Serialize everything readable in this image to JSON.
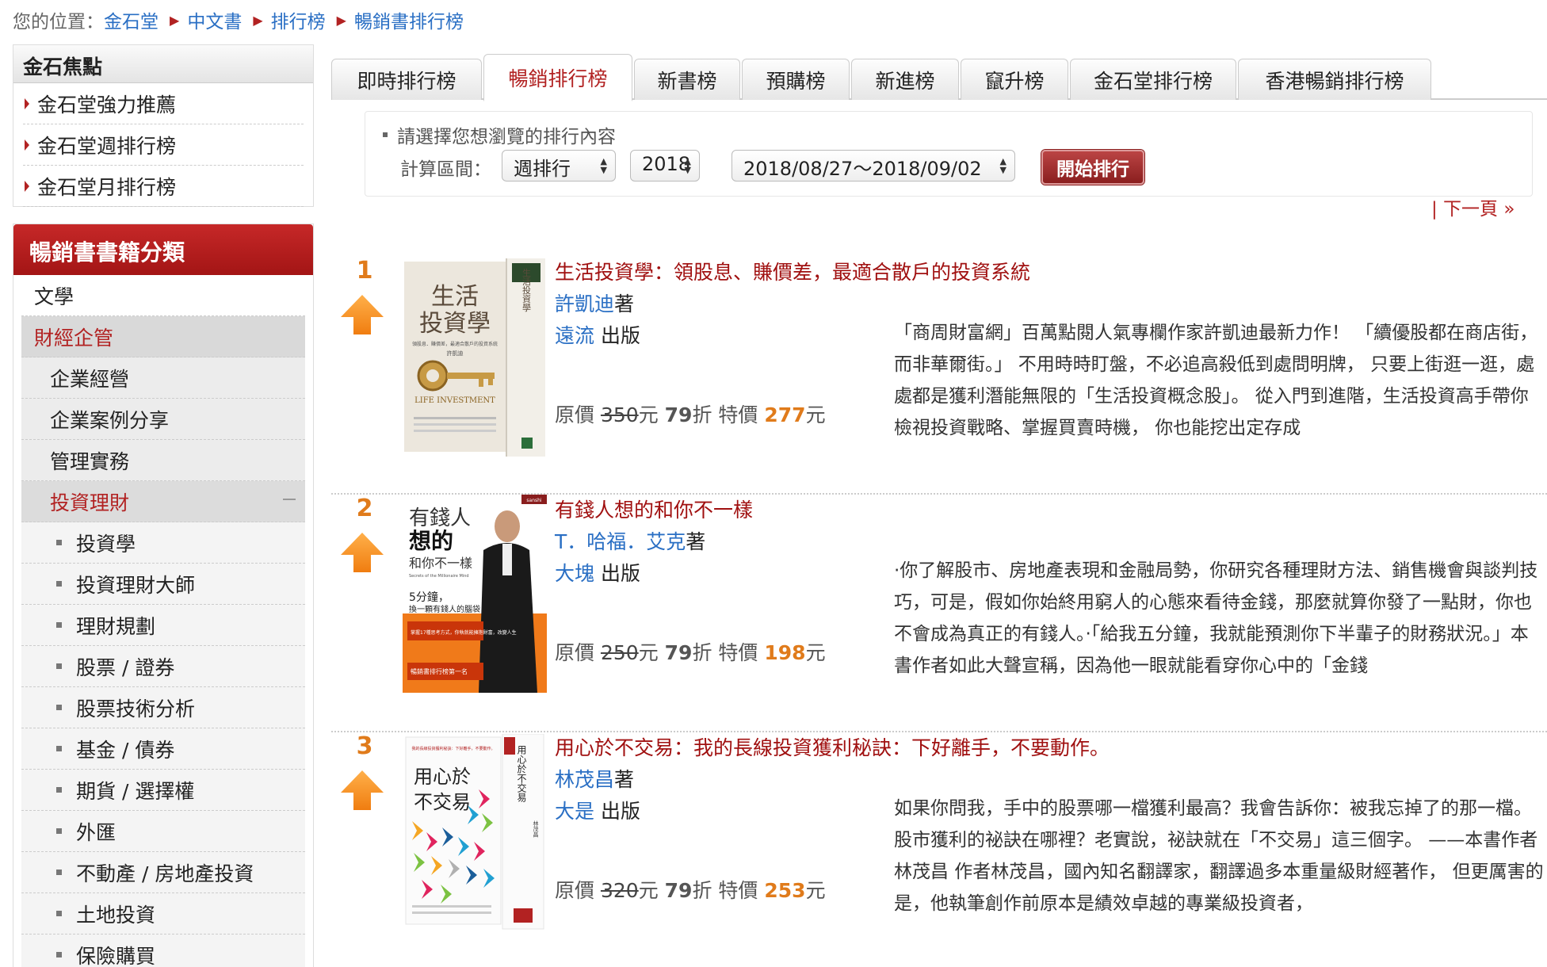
{
  "breadcrumb": {
    "label": "您的位置：",
    "items": [
      "金石堂",
      "中文書",
      "排行榜",
      "暢銷書排行榜"
    ]
  },
  "sidebar": {
    "focus": {
      "title": "金石焦點",
      "items": [
        "金石堂強力推薦",
        "金石堂週排行榜",
        "金石堂月排行榜"
      ]
    },
    "categories": {
      "title": "暢銷書書籍分類",
      "top": [
        "文學",
        "財經企管"
      ],
      "sub": [
        "企業經營",
        "企業案例分享",
        "管理實務",
        "投資理財"
      ],
      "subsub": [
        "投資學",
        "投資理財大師",
        "理財規劃",
        "股票 / 證券",
        "股票技術分析",
        "基金 / 債券",
        "期貨 / 選擇權",
        "外匯",
        "不動產 / 房地產投資",
        "土地投資",
        "保險購買"
      ]
    }
  },
  "tabs": [
    "即時排行榜",
    "暢銷排行榜",
    "新書榜",
    "預購榜",
    "新進榜",
    "竄升榜",
    "金石堂排行榜",
    "香港暢銷排行榜"
  ],
  "active_tab": "暢銷排行榜",
  "filter": {
    "hint": "請選擇您想瀏覽的排行內容",
    "label": "計算區間：",
    "period": "週排行",
    "year": "2018",
    "range": "2018/08/27～2018/09/02",
    "button": "開始排行"
  },
  "pagination": {
    "next": "| 下一頁 »"
  },
  "price_labels": {
    "orig": "原價",
    "currency": "元",
    "discount_suffix": "折",
    "special": "特價",
    "author_suffix": "著",
    "publisher_suffix": " 出版"
  },
  "books": [
    {
      "rank": "1",
      "title": "生活投資學：領股息、賺價差，最適合散戶的投資系統",
      "author": "許凱迪",
      "publisher": "遠流",
      "orig_price": "350",
      "discount": "79",
      "special_price": "277",
      "description": "「商周財富網」百萬點閱人氣專欄作家許凱迪最新力作！ 「續優股都在商店街，而非華爾街。」 不用時時盯盤，不必追高殺低到處問明牌， 只要上街逛一逛，處處都是獲利潛能無限的「生活投資概念股」。 從入門到進階，生活投資高手帶你檢視投資戰略、掌握買賣時機， 你也能挖出定存成",
      "cover": {
        "title": "生活投資學",
        "subtitle": "領股息．賺價差，最適合散戶的投資系統",
        "author": "許凱迪",
        "en": "LIFE INVESTMENT",
        "spine": "生活投資學"
      }
    },
    {
      "rank": "2",
      "title": "有錢人想的和你不一樣",
      "author": "T．哈福．艾克",
      "publisher": "大塊",
      "orig_price": "250",
      "discount": "79",
      "special_price": "198",
      "description": "·你了解股市、房地產表現和金融局勢，你研究各種理財方法、銷售機會與談判技巧，可是，假如你始終用窮人的心態來看待金錢，那麼就算你發了一點財，你也不會成為真正的有錢人。·「給我五分鐘，我就能預測你下半輩子的財務狀況。」本書作者如此大聲宣稱，因為他一眼就能看穿你心中的「金錢",
      "cover": {
        "line1": "有錢人",
        "line2": "想的",
        "line3": "和你不一樣",
        "en": "Secrets of the Millionaire Mind",
        "tag": "5分鐘，",
        "tag2": "換一顆有錢人的腦袋",
        "band": "掌握17種思考方式，你執就能擁抱財富，改變人生",
        "foot": "暢銷書排行榜第一名",
        "badge": "sanshi"
      }
    },
    {
      "rank": "3",
      "title": "用心於不交易：我的長線投資獲利秘訣：下好離手，不要動作。",
      "author": "林茂昌",
      "publisher": "大是",
      "orig_price": "320",
      "discount": "79",
      "special_price": "253",
      "description": "如果你問我，手中的股票哪一檔獲利最高？我會告訴你：被我忘掉了的那一檔。 股市獲利的祕訣在哪裡？老實說，祕訣就在「不交易」這三個字。 ——本書作者林茂昌 作者林茂昌，國內知名翻譯家，翻譯過多本重量級財經著作， 但更厲害的是，他執筆創作前原本是績效卓越的專業級投資者，",
      "cover": {
        "title1": "用心於",
        "title2": "不交易",
        "top": "我的長線投資獲利秘訣：下好離手，不要動作。",
        "spine": "用心於不交易",
        "author": "林茂昌"
      }
    }
  ],
  "colors": {
    "brand": "#b22222",
    "link": "#2a6fc4",
    "accent": "#e07b1b"
  }
}
